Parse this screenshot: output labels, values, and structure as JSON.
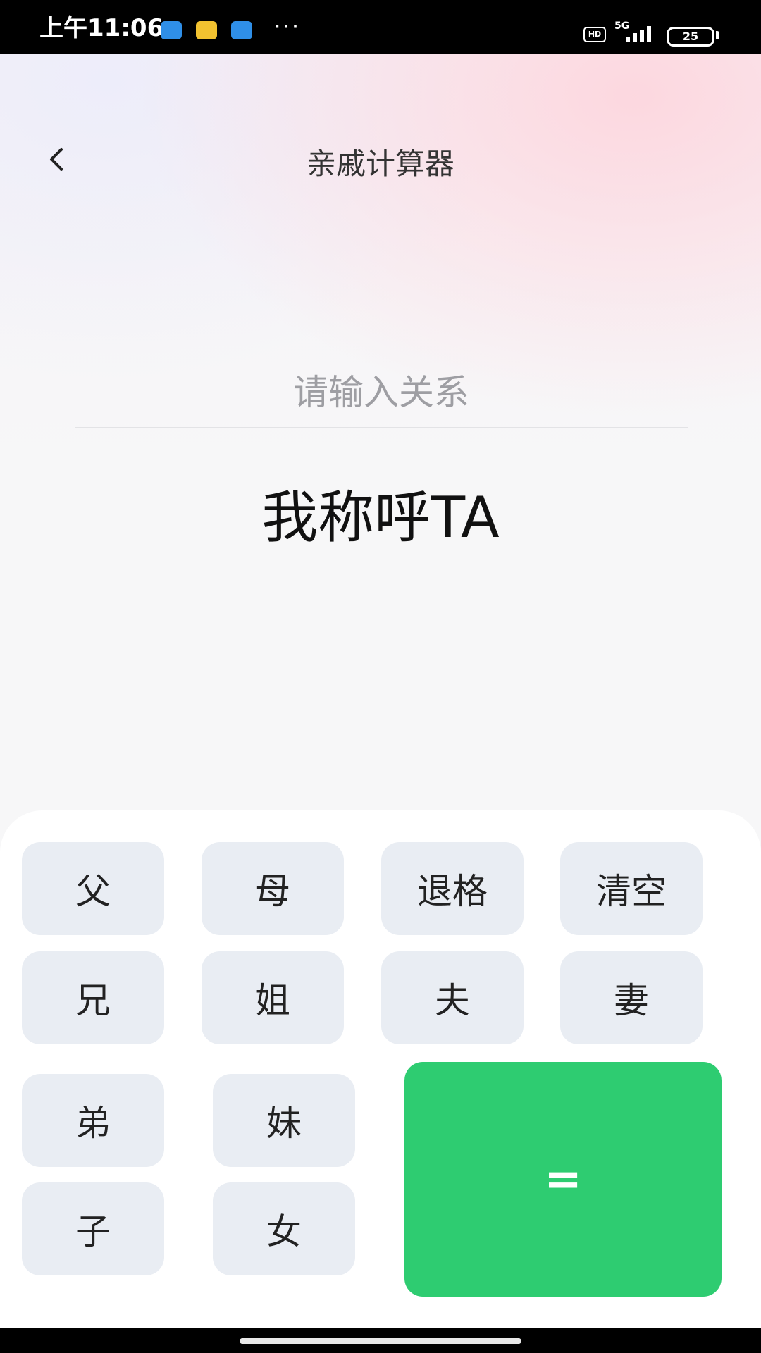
{
  "status_bar": {
    "time": "上午11:06",
    "dots": "···",
    "hd": "HD",
    "network": "5G",
    "battery": "25"
  },
  "header": {
    "title": "亲戚计算器"
  },
  "input": {
    "placeholder": "请输入关系",
    "value": ""
  },
  "result": {
    "text": "我称呼TA"
  },
  "keypad": {
    "keys": [
      "父",
      "母",
      "退格",
      "清空",
      "兄",
      "姐",
      "夫",
      "妻",
      "弟",
      "妹",
      "子",
      "女"
    ],
    "equal_label": "="
  },
  "colors": {
    "accent": "#2ecc71",
    "key_bg": "#e9edf3"
  }
}
